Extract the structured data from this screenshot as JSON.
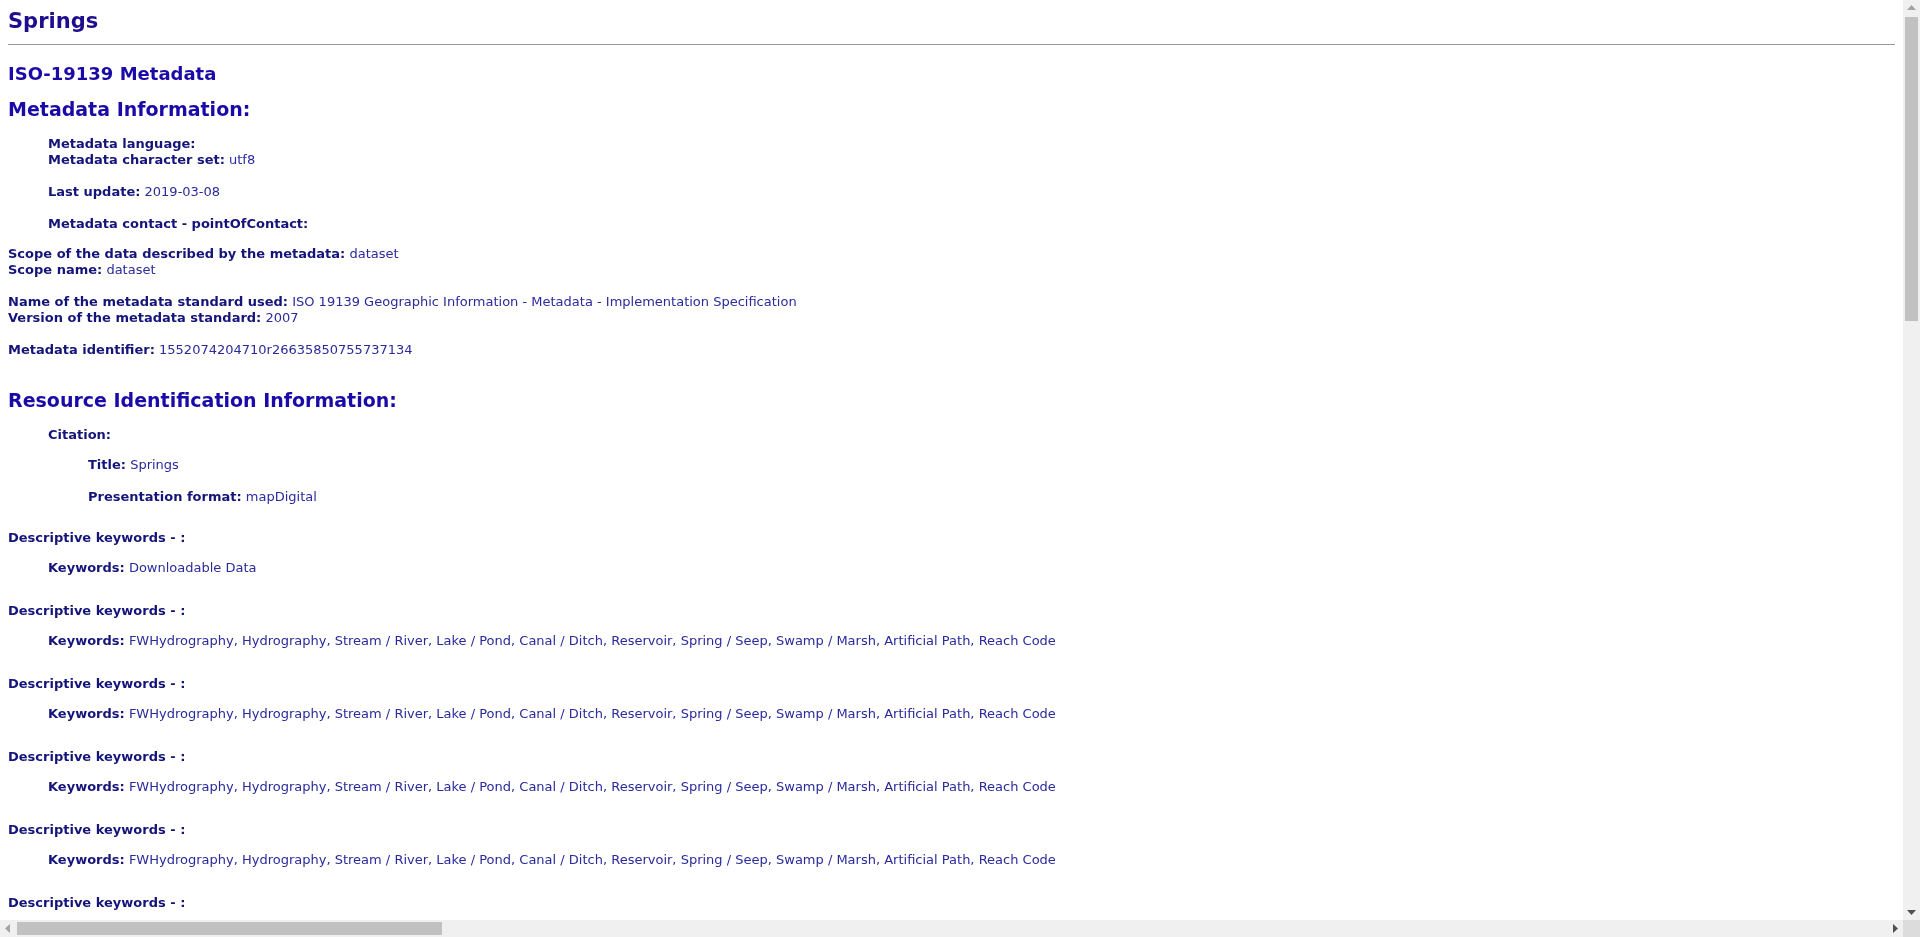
{
  "title": "Springs",
  "subtitle": "ISO-19139 Metadata",
  "sections": [
    {
      "heading": "Metadata Information:",
      "blocks": [
        {
          "children": [
            {
              "lines": [
                {
                  "label": "Metadata language:"
                },
                {
                  "label": "Metadata character set:",
                  "value": "utf8"
                }
              ]
            },
            {
              "lines": [
                {
                  "label": "Last update:",
                  "value": "2019-03-08"
                }
              ]
            },
            {
              "lines": [
                {
                  "label": "Metadata contact - pointOfContact:"
                }
              ]
            }
          ]
        },
        {
          "lines": [
            {
              "label": "Scope of the data described by the metadata:",
              "value": "dataset"
            },
            {
              "label": "Scope name:",
              "value": "dataset"
            }
          ]
        },
        {
          "lines": [
            {
              "label": "Name of the metadata standard used:",
              "value": "ISO 19139 Geographic Information - Metadata - Implementation Specification"
            },
            {
              "label": "Version of the metadata standard:",
              "value": "2007"
            }
          ]
        },
        {
          "lines": [
            {
              "label": "Metadata identifier:",
              "value": "1552074204710r26635850755737134"
            }
          ]
        }
      ]
    },
    {
      "heading": "Resource Identification Information:",
      "blocks": [
        {
          "children": [
            {
              "lines": [
                {
                  "label": "Citation:"
                }
              ],
              "children": [
                {
                  "lines": [
                    {
                      "label": "Title:",
                      "value": "Springs"
                    }
                  ]
                },
                {
                  "lines": [
                    {
                      "label": "Presentation format:",
                      "value": "mapDigital"
                    }
                  ]
                }
              ]
            }
          ]
        },
        {
          "lines": [
            {
              "label": "Descriptive keywords - :"
            }
          ],
          "children": [
            {
              "lines": [
                {
                  "label": "Keywords:",
                  "value": "Downloadable Data"
                }
              ]
            }
          ]
        },
        {
          "lines": [
            {
              "label": "Descriptive keywords - :"
            }
          ],
          "children": [
            {
              "lines": [
                {
                  "label": "Keywords:",
                  "value": "FWHydrography, Hydrography, Stream / River, Lake / Pond, Canal / Ditch, Reservoir, Spring / Seep, Swamp / Marsh, Artificial Path, Reach Code"
                }
              ]
            }
          ]
        },
        {
          "lines": [
            {
              "label": "Descriptive keywords - :"
            }
          ],
          "children": [
            {
              "lines": [
                {
                  "label": "Keywords:",
                  "value": "FWHydrography, Hydrography, Stream / River, Lake / Pond, Canal / Ditch, Reservoir, Spring / Seep, Swamp / Marsh, Artificial Path, Reach Code"
                }
              ]
            }
          ]
        },
        {
          "lines": [
            {
              "label": "Descriptive keywords - :"
            }
          ],
          "children": [
            {
              "lines": [
                {
                  "label": "Keywords:",
                  "value": "FWHydrography, Hydrography, Stream / River, Lake / Pond, Canal / Ditch, Reservoir, Spring / Seep, Swamp / Marsh, Artificial Path, Reach Code"
                }
              ]
            }
          ]
        },
        {
          "lines": [
            {
              "label": "Descriptive keywords - :"
            }
          ],
          "children": [
            {
              "lines": [
                {
                  "label": "Keywords:",
                  "value": "FWHydrography, Hydrography, Stream / River, Lake / Pond, Canal / Ditch, Reservoir, Spring / Seep, Swamp / Marsh, Artificial Path, Reach Code"
                }
              ]
            }
          ]
        },
        {
          "lines": [
            {
              "label": "Descriptive keywords - :"
            }
          ]
        }
      ]
    }
  ]
}
